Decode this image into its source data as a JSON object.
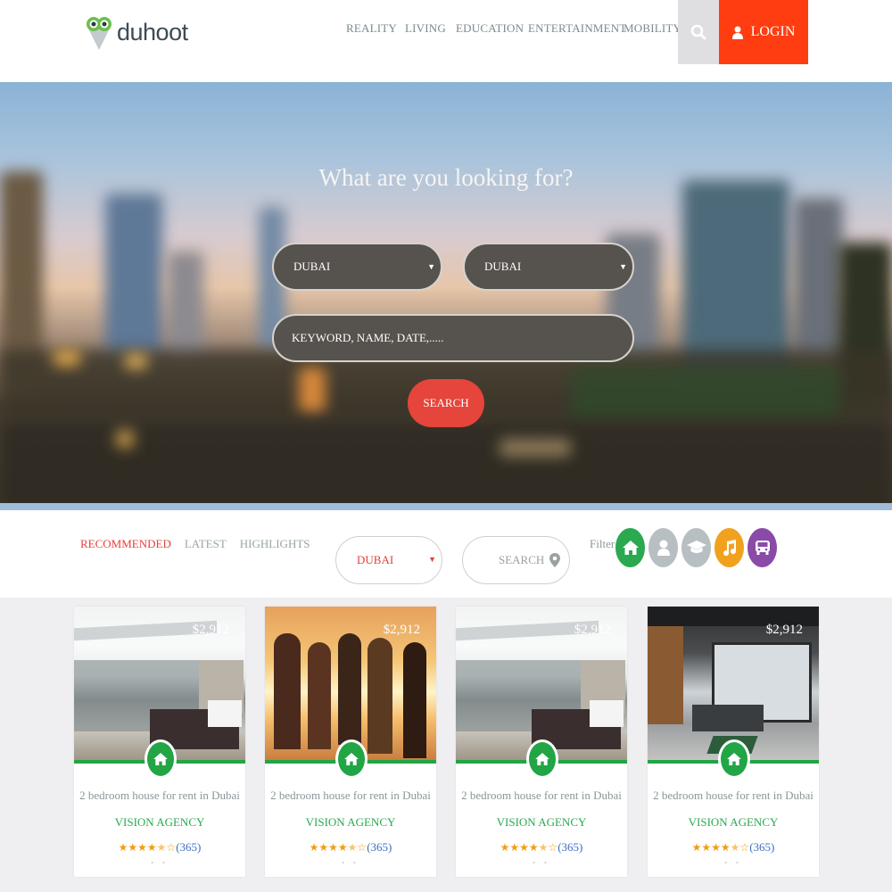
{
  "brand": {
    "name": "duhoot"
  },
  "nav": {
    "items": [
      "REALITY",
      "LIVING",
      "EDUCATION",
      "ENTERTAINMENT",
      "MOBILITY"
    ],
    "login_label": "LOGIN"
  },
  "hero": {
    "title": "What are you looking for?",
    "select1": "DUBAI",
    "select2": "DUBAI",
    "keyword_placeholder": "KEYWORD, NAME, DATE,.....",
    "search_label": "SEARCH"
  },
  "filters": {
    "tabs": [
      "RECOMMENDED",
      "LATEST",
      "HIGHLIGHTS"
    ],
    "city": "DUBAI",
    "search_label": "SEARCH",
    "filter_label": "Filter",
    "icons": [
      {
        "name": "home-icon",
        "color": "#2aa950"
      },
      {
        "name": "person-icon",
        "color": "#b8bfc2"
      },
      {
        "name": "graduation-cap-icon",
        "color": "#b8bfc2"
      },
      {
        "name": "music-icon",
        "color": "#f0a21e"
      },
      {
        "name": "bus-icon",
        "color": "#8a4ba8"
      }
    ]
  },
  "cards": [
    {
      "price": "$2,912",
      "title": "2 bedroom house for rent in Dubai",
      "agency": "VISION AGENCY",
      "rating": 4.5,
      "reviews": "(365)"
    },
    {
      "price": "$2,912",
      "title": "2 bedroom house for rent in Dubai",
      "agency": "VISION AGENCY",
      "rating": 4.5,
      "reviews": "(365)"
    },
    {
      "price": "$2,912",
      "title": "2 bedroom house for rent in Dubai",
      "agency": "VISION AGENCY",
      "rating": 4.5,
      "reviews": "(365)"
    },
    {
      "price": "$2,912",
      "title": "2 bedroom house for rent in Dubai",
      "agency": "VISION AGENCY",
      "rating": 4.5,
      "reviews": "(365)"
    }
  ],
  "colors": {
    "accent": "#ff3d11",
    "green": "#22a545",
    "red": "#e2413b"
  }
}
